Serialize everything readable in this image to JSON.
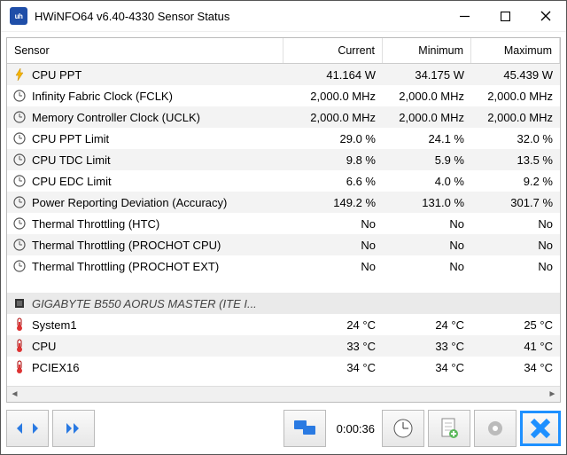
{
  "window": {
    "title": "HWiNFO64 v6.40-4330 Sensor Status",
    "app_icon_text": "uh"
  },
  "columns": {
    "sensor": "Sensor",
    "current": "Current",
    "minimum": "Minimum",
    "maximum": "Maximum"
  },
  "rows": [
    {
      "icon": "bolt",
      "name": "CPU PPT",
      "cur": "41.164 W",
      "min": "34.175 W",
      "max": "45.439 W",
      "even": true
    },
    {
      "icon": "clock",
      "name": "Infinity Fabric Clock (FCLK)",
      "cur": "2,000.0 MHz",
      "min": "2,000.0 MHz",
      "max": "2,000.0 MHz",
      "even": false
    },
    {
      "icon": "clock",
      "name": "Memory Controller Clock (UCLK)",
      "cur": "2,000.0 MHz",
      "min": "2,000.0 MHz",
      "max": "2,000.0 MHz",
      "even": true
    },
    {
      "icon": "clock",
      "name": "CPU PPT Limit",
      "cur": "29.0 %",
      "min": "24.1 %",
      "max": "32.0 %",
      "even": false
    },
    {
      "icon": "clock",
      "name": "CPU TDC Limit",
      "cur": "9.8 %",
      "min": "5.9 %",
      "max": "13.5 %",
      "even": true
    },
    {
      "icon": "clock",
      "name": "CPU EDC Limit",
      "cur": "6.6 %",
      "min": "4.0 %",
      "max": "9.2 %",
      "even": false
    },
    {
      "icon": "clock",
      "name": "Power Reporting Deviation (Accuracy)",
      "cur": "149.2 %",
      "min": "131.0 %",
      "max": "301.7 %",
      "even": true
    },
    {
      "icon": "clock",
      "name": "Thermal Throttling (HTC)",
      "cur": "No",
      "min": "No",
      "max": "No",
      "even": false
    },
    {
      "icon": "clock",
      "name": "Thermal Throttling (PROCHOT CPU)",
      "cur": "No",
      "min": "No",
      "max": "No",
      "even": true
    },
    {
      "icon": "clock",
      "name": "Thermal Throttling (PROCHOT EXT)",
      "cur": "No",
      "min": "No",
      "max": "No",
      "even": false
    }
  ],
  "group": {
    "icon": "chip",
    "name": "GIGABYTE B550 AORUS MASTER (ITE I..."
  },
  "rows2": [
    {
      "icon": "therm",
      "name": "System1",
      "cur": "24 °C",
      "min": "24 °C",
      "max": "25 °C",
      "even": false
    },
    {
      "icon": "therm",
      "name": "CPU",
      "cur": "33 °C",
      "min": "33 °C",
      "max": "41 °C",
      "even": true
    },
    {
      "icon": "therm",
      "name": "PCIEX16",
      "cur": "34 °C",
      "min": "34 °C",
      "max": "34 °C",
      "even": false
    }
  ],
  "timer": "0:00:36"
}
